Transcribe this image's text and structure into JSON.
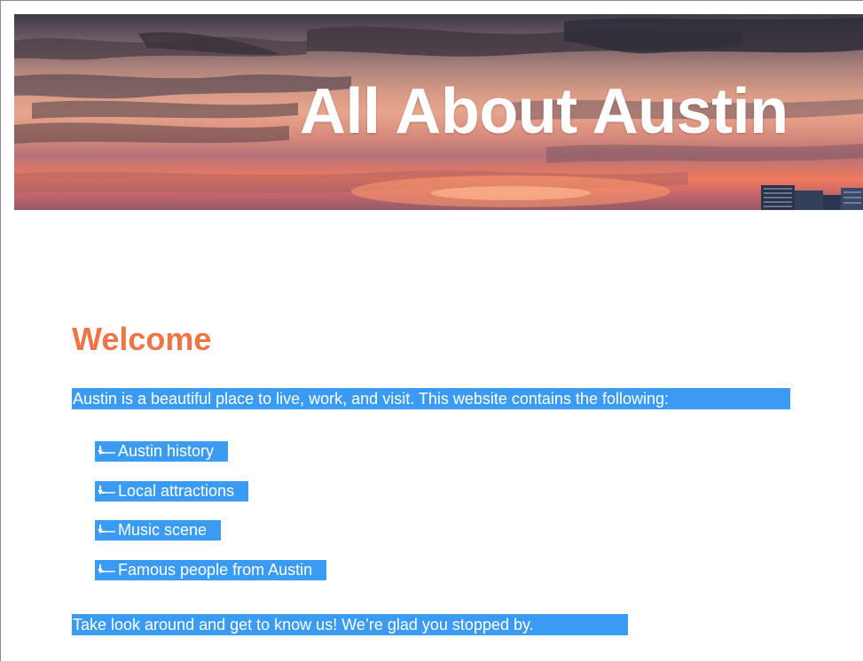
{
  "banner": {
    "title": "All About Austin"
  },
  "content": {
    "heading": "Welcome",
    "intro": "Austin is a beautiful place to live, work, and visit. This website contains the following:",
    "list_items": [
      "Austin history",
      "Local attractions",
      "Music scene",
      "Famous people from Austin"
    ],
    "outro": "Take look around and get to know us! We’re glad you stopped by."
  },
  "colors": {
    "heading": "#ef7446",
    "selection": "#3b9bf3",
    "selection_text": "#ffffff",
    "title_text": "#ffffff"
  },
  "icons": {
    "list_marker": "tab-arrow-icon"
  }
}
